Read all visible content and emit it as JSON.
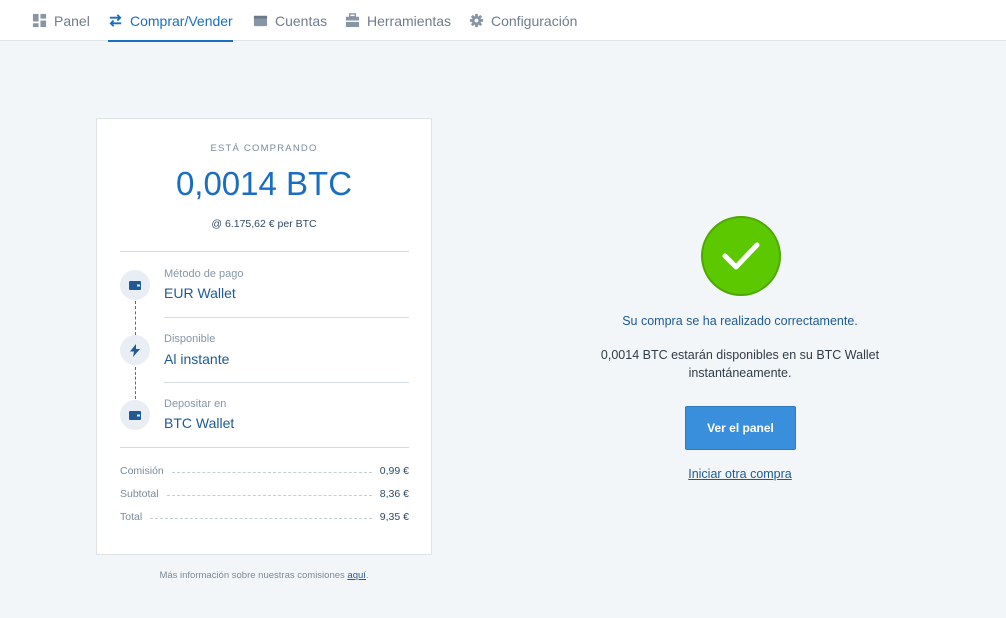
{
  "nav": {
    "items": [
      {
        "label": "Panel",
        "icon": "dashboard-icon"
      },
      {
        "label": "Comprar/Vender",
        "icon": "swap-arrows-icon"
      },
      {
        "label": "Cuentas",
        "icon": "wallet-icon"
      },
      {
        "label": "Herramientas",
        "icon": "toolbox-icon"
      },
      {
        "label": "Configuración",
        "icon": "gear-icon"
      }
    ],
    "active_index": 1
  },
  "order": {
    "buying_label": "ESTÁ COMPRANDO",
    "amount": "0,0014 BTC",
    "rate": "@ 6.175,62 € per BTC",
    "payment_method_label": "Método de pago",
    "payment_method": "EUR Wallet",
    "available_label": "Disponible",
    "available": "Al instante",
    "deposit_label": "Depositar en",
    "deposit": "BTC Wallet",
    "fees": [
      {
        "label": "Comisión",
        "value": "0,99 €"
      },
      {
        "label": "Subtotal",
        "value": "8,36 €"
      },
      {
        "label": "Total",
        "value": "9,35 €"
      }
    ]
  },
  "footnote": {
    "text": "Más información sobre nuestras comisiones ",
    "link": "aquí",
    "end": "."
  },
  "success": {
    "title": "Su compra se ha realizado correctamente.",
    "message": "0,0014 BTC estarán disponibles en su BTC Wallet instantáneamente.",
    "button": "Ver el panel",
    "link": "Iniciar otra compra"
  },
  "colors": {
    "accent": "#1a6ec1",
    "success": "#5cc800",
    "button": "#3a8fdd"
  }
}
